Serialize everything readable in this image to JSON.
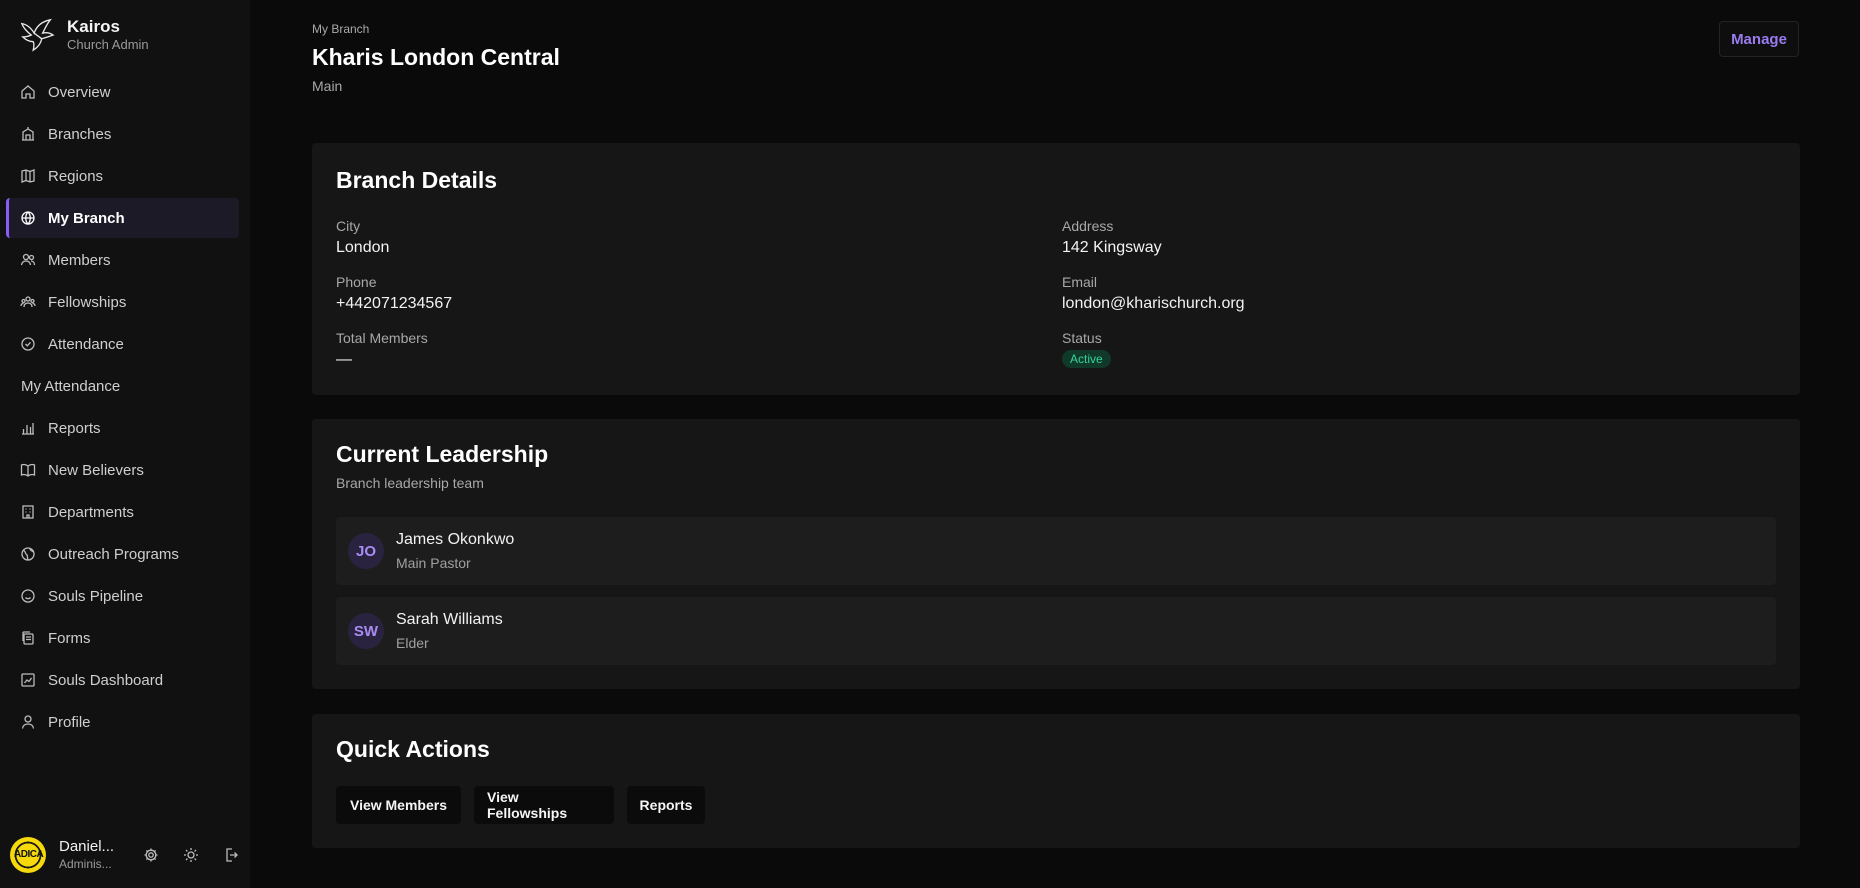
{
  "app": {
    "name": "Kairos",
    "subtitle": "Church Admin"
  },
  "sidebar": {
    "items": [
      {
        "label": "Overview",
        "icon": "home-icon"
      },
      {
        "label": "Branches",
        "icon": "building-icon"
      },
      {
        "label": "Regions",
        "icon": "map-icon"
      },
      {
        "label": "My Branch",
        "icon": "globe-icon",
        "active": true
      },
      {
        "label": "Members",
        "icon": "users-icon"
      },
      {
        "label": "Fellowships",
        "icon": "group-icon"
      },
      {
        "label": "Attendance",
        "icon": "check-circle-icon"
      },
      {
        "label": "My Attendance",
        "icon": ""
      },
      {
        "label": "Reports",
        "icon": "bar-chart-icon"
      },
      {
        "label": "New Believers",
        "icon": "book-icon"
      },
      {
        "label": "Departments",
        "icon": "office-icon"
      },
      {
        "label": "Outreach Programs",
        "icon": "outreach-globe-icon"
      },
      {
        "label": "Souls Pipeline",
        "icon": "smile-icon"
      },
      {
        "label": "Forms",
        "icon": "forms-icon"
      },
      {
        "label": "Souls Dashboard",
        "icon": "dashboard-icon"
      },
      {
        "label": "Profile",
        "icon": "user-icon"
      }
    ]
  },
  "user": {
    "name": "Daniel...",
    "role": "Adminis...",
    "avatar_text": "ADICA"
  },
  "header": {
    "breadcrumb": "My Branch",
    "title": "Kharis London Central",
    "subtitle": "Main",
    "manage_label": "Manage"
  },
  "details": {
    "title": "Branch Details",
    "city_label": "City",
    "city": "London",
    "address_label": "Address",
    "address": "142 Kingsway",
    "phone_label": "Phone",
    "phone": "+442071234567",
    "email_label": "Email",
    "email": "london@kharischurch.org",
    "total_label": "Total Members",
    "total": "—",
    "status_label": "Status",
    "status": "Active"
  },
  "leadership": {
    "title": "Current Leadership",
    "subtitle": "Branch leadership team",
    "leaders": [
      {
        "initials": "JO",
        "name": "James Okonkwo",
        "role": "Main Pastor"
      },
      {
        "initials": "SW",
        "name": "Sarah Williams",
        "role": "Elder"
      }
    ]
  },
  "quick_actions": {
    "title": "Quick Actions",
    "buttons": [
      "View Members",
      "View Fellowships",
      "Reports"
    ]
  },
  "colors": {
    "accent": "#8b5cf6",
    "status_green": "#34d399",
    "background": "#0a0a0a",
    "card": "#161616"
  }
}
